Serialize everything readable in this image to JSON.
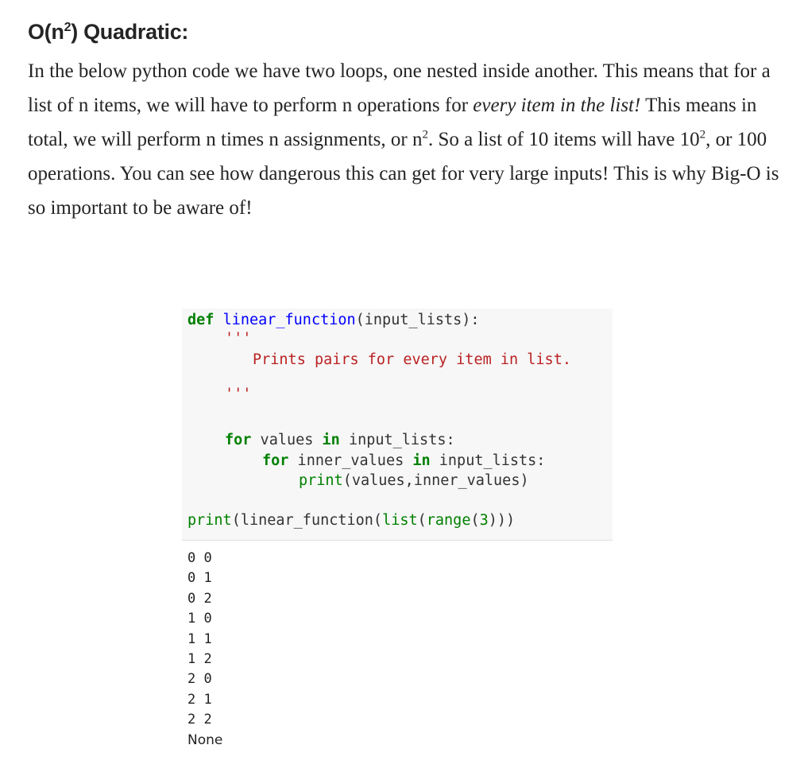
{
  "heading": {
    "prefix": "O(n",
    "sup": "2",
    "suffix": ") Quadratic:"
  },
  "paragraph": {
    "part1": "In the below python code we have two loops, one nested inside another. This means that for a list of n items, we will have to perform n operations for ",
    "emphasis": "every item in the list!",
    "part2": " This means in total, we will perform n times n assignments, or n",
    "sup1": "2",
    "part3": ". So a list of 10 items will have 10",
    "sup2": "2",
    "part4": ", or 100 operations. You can see how dangerous this can get for very large inputs! This is why Big-O is so important to be aware of!"
  },
  "code": {
    "def_keyword": "def",
    "function_name": "linear_function",
    "params": "(input_lists):",
    "docstring_open": "'''",
    "docstring_text": "Prints pairs for every item in list.",
    "docstring_close": "'''",
    "for_keyword": "for",
    "outer_var": " values ",
    "in_keyword": "in",
    "outer_iter": " input_lists:",
    "inner_var": " inner_values ",
    "inner_iter": " input_lists:",
    "print_builtin": "print",
    "print_args": "(values,inner_values)",
    "call_open": "(linear_function(",
    "list_builtin": "list",
    "range_builtin": "range",
    "range_num": "3",
    "call_close": ")))"
  },
  "output": {
    "lines": [
      "0 0",
      "0 1",
      "0 2",
      "1 0",
      "1 1",
      "1 2",
      "2 0",
      "2 1",
      "2 2"
    ],
    "final": "None"
  }
}
